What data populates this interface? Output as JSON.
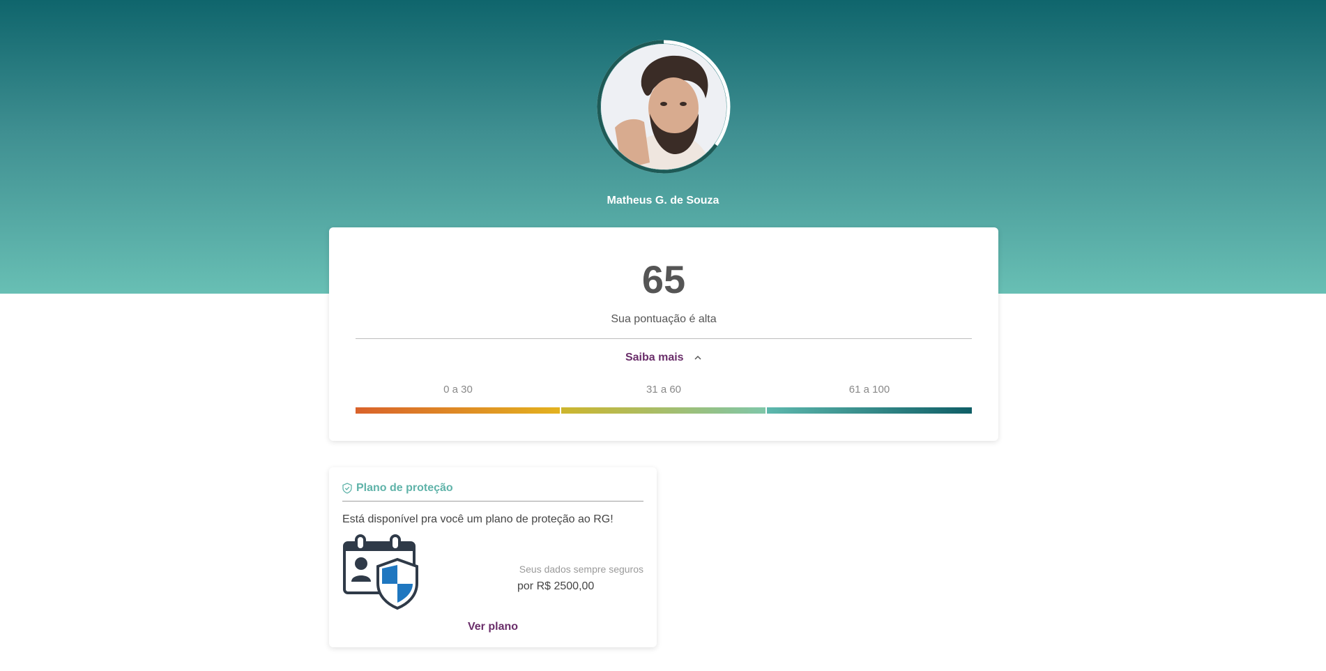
{
  "profile": {
    "name": "Matheus G. de Souza",
    "avatar_icon": "user-photo"
  },
  "score": {
    "value": "65",
    "description": "Sua pontuação é alta",
    "progress_percent": 65,
    "toggle_label": "Saiba mais",
    "ranges": [
      {
        "label": "0 a 30"
      },
      {
        "label": "31 a 60"
      },
      {
        "label": "61 a 100"
      }
    ]
  },
  "plan": {
    "title": "Plano de proteção",
    "description": "Está disponível pra você um plano de proteção ao RG!",
    "note": "Seus dados sempre seguros",
    "price": "por R$ 2500,00",
    "link_label": "Ver plano"
  },
  "colors": {
    "header_top": "#0f656c",
    "header_bottom": "#68bfb4",
    "accent_purple": "#6a2e6a",
    "accent_teal": "#5fb3a9",
    "range_low": "#d9622b",
    "range_mid": "#e3b21f",
    "range_high": "#0f5e66"
  }
}
